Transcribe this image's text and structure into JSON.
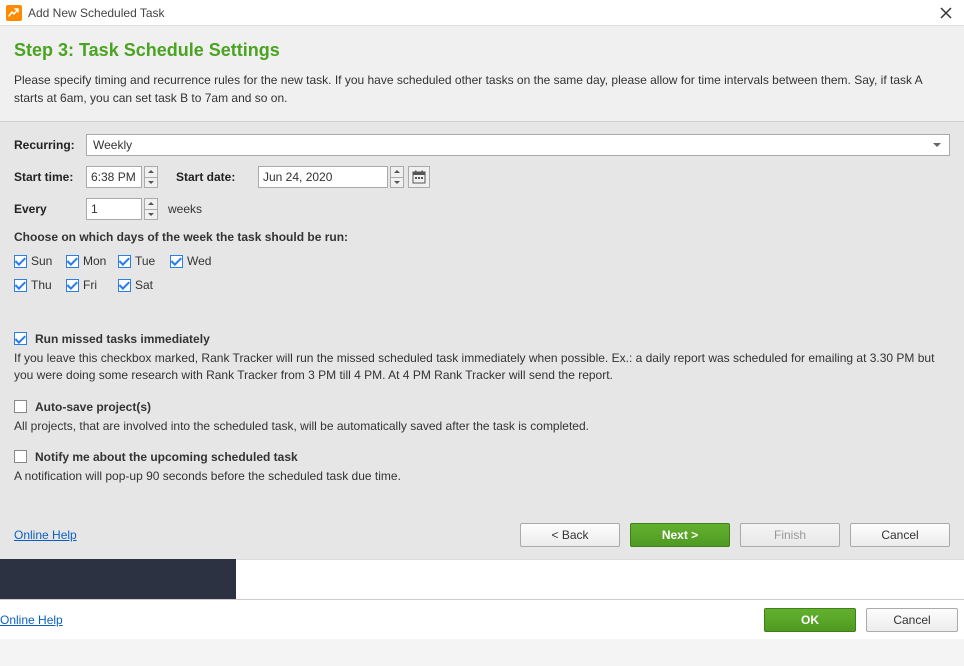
{
  "window": {
    "title": "Add New Scheduled Task"
  },
  "header": {
    "step_title": "Step 3: Task Schedule Settings",
    "description": "Please specify timing and recurrence rules for the new task. If you have scheduled other tasks on the same day, please allow for time intervals between them. Say, if task A starts at 6am, you can set task B to 7am and so on."
  },
  "form": {
    "recurring_label": "Recurring:",
    "recurring_value": "Weekly",
    "start_time_label": "Start time:",
    "start_time_value": "6:38 PM",
    "start_date_label": "Start date:",
    "start_date_value": "Jun 24, 2020",
    "every_label": "Every",
    "every_value": "1",
    "weeks_label": "weeks",
    "days_prompt": "Choose on which days of the week the task should be run:",
    "days_row1": [
      "Sun",
      "Mon",
      "Tue",
      "Wed"
    ],
    "days_row2": [
      "Thu",
      "Fri",
      "Sat"
    ]
  },
  "options": {
    "run_missed": {
      "label": "Run missed tasks immediately",
      "desc": "If you leave this checkbox marked, Rank Tracker will run the missed scheduled task immediately when possible. Ex.: a daily report was scheduled for emailing at 3.30 PM but you were doing some research with Rank Tracker from 3 PM till 4 PM. At 4 PM Rank Tracker will send the report."
    },
    "auto_save": {
      "label": "Auto-save project(s)",
      "desc": "All projects, that are involved into the scheduled task, will be automatically saved after the task is completed."
    },
    "notify": {
      "label": "Notify me about the upcoming scheduled task",
      "desc": "A notification will pop-up 90 seconds before the scheduled task due time."
    }
  },
  "footer": {
    "help_link": "Online Help",
    "back": "< Back",
    "next": "Next >",
    "finish": "Finish",
    "cancel": "Cancel"
  },
  "bottom": {
    "help_link": "Online Help",
    "ok": "OK",
    "cancel": "Cancel"
  }
}
